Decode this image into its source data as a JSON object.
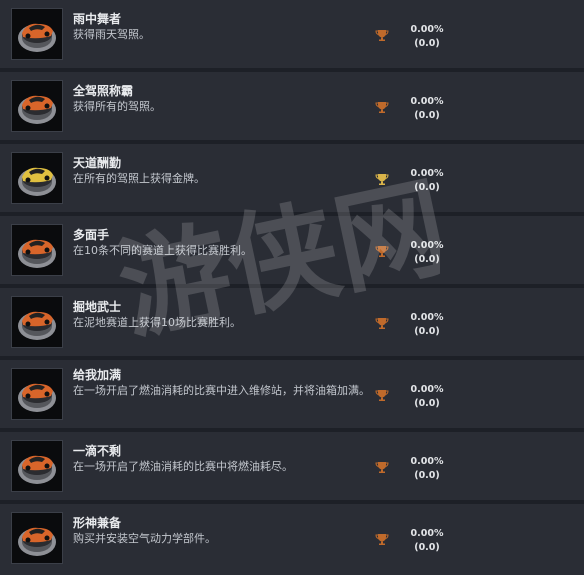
{
  "achievements": [
    {
      "title": "雨中舞者",
      "description": "获得雨天驾照。",
      "percent": "0.00%",
      "count": "(0.0)",
      "icon": "car-achievement-icon",
      "trophy": "bronze"
    },
    {
      "title": "全驾照称霸",
      "description": "获得所有的驾照。",
      "percent": "0.00%",
      "count": "(0.0)",
      "icon": "car-achievement-icon",
      "trophy": "bronze"
    },
    {
      "title": "天道酬勤",
      "description": "在所有的驾照上获得金牌。",
      "percent": "0.00%",
      "count": "(0.0)",
      "icon": "car-achievement-icon",
      "trophy": "gold"
    },
    {
      "title": "多面手",
      "description": "在10条不同的赛道上获得比赛胜利。",
      "percent": "0.00%",
      "count": "(0.0)",
      "icon": "car-achievement-icon",
      "trophy": "bronze"
    },
    {
      "title": "掘地武士",
      "description": "在泥地赛道上获得10场比赛胜利。",
      "percent": "0.00%",
      "count": "(0.0)",
      "icon": "car-achievement-icon",
      "trophy": "bronze"
    },
    {
      "title": "给我加满",
      "description": "在一场开启了燃油消耗的比赛中进入维修站，并将油箱加满。",
      "percent": "0.00%",
      "count": "(0.0)",
      "icon": "car-achievement-icon",
      "trophy": "bronze"
    },
    {
      "title": "一滴不剩",
      "description": "在一场开启了燃油消耗的比赛中将燃油耗尽。",
      "percent": "0.00%",
      "count": "(0.0)",
      "icon": "car-achievement-icon",
      "trophy": "bronze"
    },
    {
      "title": "形神兼备",
      "description": "购买并安装空气动力学部件。",
      "percent": "0.00%",
      "count": "(0.0)",
      "icon": "car-achievement-icon",
      "trophy": "bronze"
    }
  ],
  "colors": {
    "bronze": "#c06a2b",
    "gold": "#d9b44a",
    "car_orange": "#d8652a",
    "car_gold": "#e0c040"
  },
  "watermark": {
    "text": "游侠网"
  }
}
